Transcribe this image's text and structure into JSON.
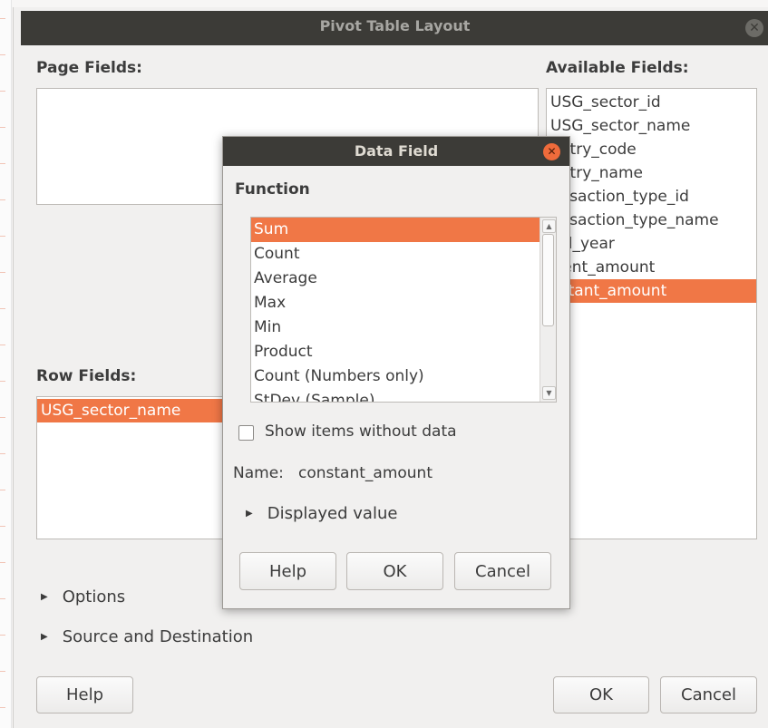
{
  "main": {
    "title": "Pivot Table Layout",
    "page_fields_label": "Page Fields:",
    "available_fields_label": "Available Fields:",
    "row_fields_label": "Row Fields:",
    "available_fields": [
      "USG_sector_id",
      "USG_sector_name",
      "untry_code",
      "untry_name",
      "ansaction_type_id",
      "ansaction_type_name",
      "cal_year",
      "rrent_amount",
      "nstant_amount"
    ],
    "available_selected_index": 8,
    "row_fields": [
      "USG_sector_name"
    ],
    "options_label": "Options",
    "source_dest_label": "Source and Destination",
    "help_label": "Help",
    "ok_label": "OK",
    "cancel_label": "Cancel"
  },
  "dialog": {
    "title": "Data Field",
    "function_label": "Function",
    "functions": [
      "Sum",
      "Count",
      "Average",
      "Max",
      "Min",
      "Product",
      "Count (Numbers only)",
      "StDev (Sample)"
    ],
    "selected_function_index": 0,
    "show_items_label": "Show items without data",
    "name_label": "Name:",
    "name_value": "constant_amount",
    "displayed_value_label": "Displayed value",
    "help_label": "Help",
    "ok_label": "OK",
    "cancel_label": "Cancel"
  },
  "colors": {
    "selection": "#f07746",
    "titlebar": "#3c3b37",
    "close_accent": "#ef6b3b"
  }
}
